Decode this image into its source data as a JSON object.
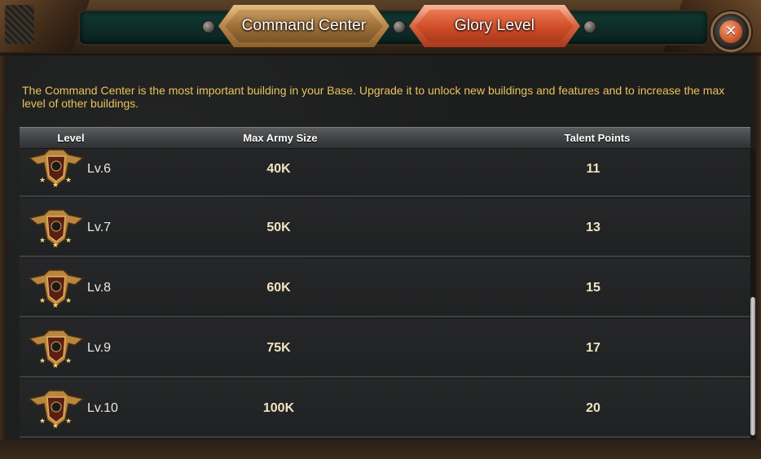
{
  "tabs": {
    "command_center": "Command Center",
    "glory_level": "Glory Level"
  },
  "close_symbol": "✕",
  "description": "The Command Center is the most important building in your Base. Upgrade it to unlock new buildings and features and to increase the max level of other buildings.",
  "table": {
    "headers": {
      "level": "Level",
      "max_army_size": "Max Army Size",
      "talent_points": "Talent Points"
    },
    "rows": [
      {
        "level": "Lv.6",
        "army": "40K",
        "talent": "11"
      },
      {
        "level": "Lv.7",
        "army": "50K",
        "talent": "13"
      },
      {
        "level": "Lv.8",
        "army": "60K",
        "talent": "15"
      },
      {
        "level": "Lv.9",
        "army": "75K",
        "talent": "17"
      },
      {
        "level": "Lv.10",
        "army": "100K",
        "talent": "20"
      }
    ]
  },
  "colors": {
    "description_text": "#e9c45a",
    "active_tab": "#cf4c28",
    "inactive_tab": "#9a6d38"
  }
}
